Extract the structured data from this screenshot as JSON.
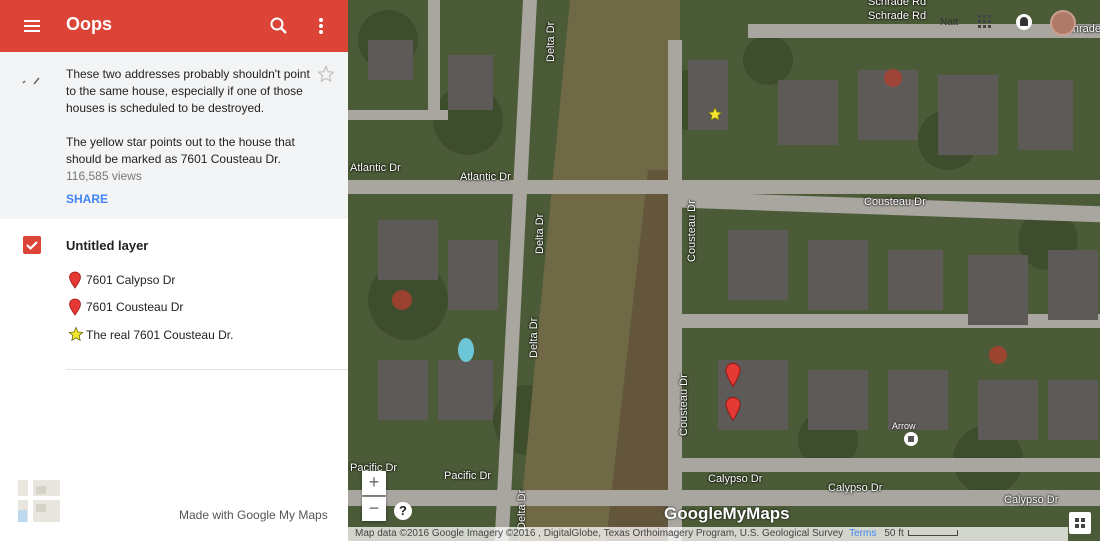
{
  "header": {
    "title": "Oops",
    "bg_color": "#db4437",
    "menu_icon": "hamburger-menu-icon",
    "search_icon": "search-icon",
    "more_icon": "more-vert-icon"
  },
  "description": {
    "text": "These two addresses probably shouldn't point to the same house, especially if one of those houses is scheduled to be destroyed.\n\nThe yellow star points out to the house that should be marked as 7601 Cousteau Dr.",
    "views": "116,585 views",
    "share_label": "SHARE",
    "star_icon": "star-outline-icon",
    "edit_icon": "edit-pencil-icon"
  },
  "layer": {
    "title": "Untitled layer",
    "checked": true,
    "features": [
      {
        "label": "7601 Calypso Dr",
        "icon": "red-pin-icon"
      },
      {
        "label": "7601 Cousteau Dr",
        "icon": "red-pin-icon"
      },
      {
        "label": "The real 7601 Cousteau Dr.",
        "icon": "yellow-star-icon"
      }
    ]
  },
  "footer": {
    "made_with": "Made with Google My Maps",
    "basemap_thumbnail_icon": "basemap-thumbnail-icon"
  },
  "map": {
    "streets": {
      "schrade_rd_1": "Schrade Rd",
      "schrade_rd_2": "Schrade Rd",
      "schrade_rd_3": "Schrade Rd",
      "delta_dr_1": "Delta Dr",
      "delta_dr_2": "Delta Dr",
      "delta_dr_3": "Delta Dr",
      "delta_dr_4": "Delta Dr",
      "atlantic_dr_1": "Atlantic Dr",
      "atlantic_dr_2": "Atlantic Dr",
      "cousteau_dr_h": "Cousteau Dr",
      "cousteau_dr_v1": "Cousteau Dr",
      "cousteau_dr_v2": "Cousteau Dr",
      "pacific_dr_1": "Pacific Dr",
      "pacific_dr_2": "Pacific Dr",
      "calypso_dr_1": "Calypso Dr",
      "calypso_dr_2": "Calypso Dr",
      "calypso_dr_3": "Calypso Dr"
    },
    "poi_label": "Arrow",
    "natt_label": "Natt",
    "zoom_in": "+",
    "zoom_out": "−",
    "help": "?",
    "logo": "GoogleMyMaps",
    "attribution": "Map data ©2016 Google Imagery ©2016 , DigitalGlobe, Texas Orthoimagery Program, U.S. Geological Survey",
    "terms": "Terms",
    "scale": "50 ft",
    "pin_color": "#e53935",
    "star_color": "#f4e42b"
  }
}
